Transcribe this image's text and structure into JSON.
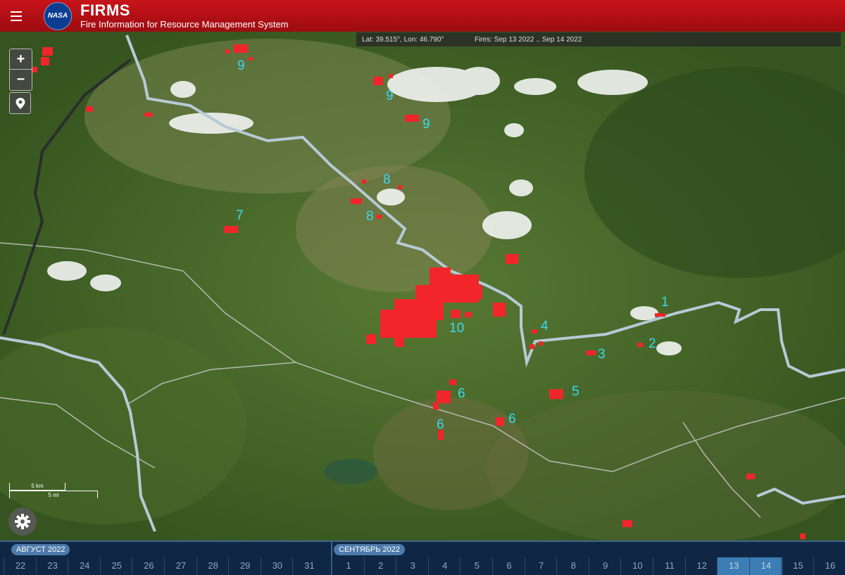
{
  "header": {
    "title": "FIRMS",
    "subtitle": "Fire Information for Resource Management System",
    "logo_text": "NASA",
    "color": "#b3101a"
  },
  "infobar": {
    "coords": "Lat: 39.515°, Lon: 46.790°",
    "fires": "Fires: Sep 13 2022 .. Sep 14 2022"
  },
  "controls": {
    "zoom_in": "+",
    "zoom_out": "−",
    "icons": [
      "plus-icon",
      "minus-icon",
      "location-pin-icon",
      "gear-icon"
    ]
  },
  "scale": {
    "km": "5 km",
    "mi": "5 mi"
  },
  "map_labels": [
    "1",
    "2",
    "3",
    "4",
    "5",
    "6",
    "6",
    "6",
    "7",
    "8",
    "8",
    "9",
    "9",
    "9",
    "10"
  ],
  "colors": {
    "fire": "#f2252a",
    "label": "#3cd8f0",
    "border": "#b6cad6",
    "road": "#c8c8c8"
  },
  "timeline": {
    "months": [
      "АВГУСТ 2022",
      "СЕНТЯБРЬ 2022"
    ],
    "august_days": [
      "22",
      "23",
      "24",
      "25",
      "26",
      "27",
      "28",
      "29",
      "30",
      "31"
    ],
    "september_days": [
      "1",
      "2",
      "3",
      "4",
      "5",
      "6",
      "7",
      "8",
      "9",
      "10",
      "11",
      "12",
      "13",
      "14",
      "15",
      "16"
    ],
    "selected_days": [
      "13",
      "14"
    ]
  }
}
